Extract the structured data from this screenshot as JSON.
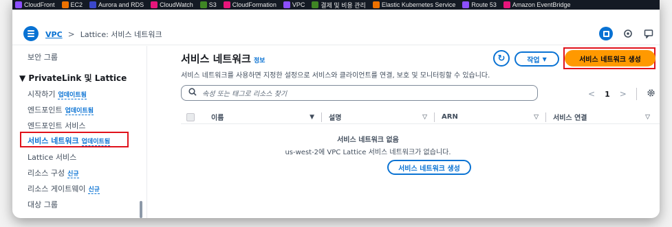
{
  "bookmarks": [
    {
      "label": "CloudFront",
      "color": "#8c4fff"
    },
    {
      "label": "EC2",
      "color": "#ed7100"
    },
    {
      "label": "Aurora and RDS",
      "color": "#3b48cc"
    },
    {
      "label": "CloudWatch",
      "color": "#e7157b"
    },
    {
      "label": "S3",
      "color": "#3f8624"
    },
    {
      "label": "CloudFormation",
      "color": "#e7157b"
    },
    {
      "label": "VPC",
      "color": "#8c4fff"
    },
    {
      "label": "결제 및 비용 관리",
      "color": "#3f8624"
    },
    {
      "label": "Elastic Kubernetes Service",
      "color": "#ed7100"
    },
    {
      "label": "Route 53",
      "color": "#8c4fff"
    },
    {
      "label": "Amazon EventBridge",
      "color": "#e7157b"
    }
  ],
  "breadcrumb": {
    "root": "VPC",
    "separator": ">",
    "current": "Lattice: 서비스 네트워크"
  },
  "sidebar": {
    "top_item": "보안 그룹",
    "section_title": "PrivateLink 및 Lattice",
    "items": [
      {
        "label": "시작하기",
        "badge": "업데이트됨"
      },
      {
        "label": "엔드포인트",
        "badge": "업데이트됨"
      },
      {
        "label": "엔드포인트 서비스",
        "badge": ""
      },
      {
        "label": "서비스 네트워크",
        "badge": "업데이트됨"
      },
      {
        "label": "Lattice 서비스",
        "badge": ""
      },
      {
        "label": "리소스 구성",
        "badge": "신규"
      },
      {
        "label": "리소스 게이트웨이",
        "badge": "신규"
      },
      {
        "label": "대상 그룹",
        "badge": ""
      }
    ]
  },
  "header": {
    "title": "서비스 네트워크",
    "info_link": "정보",
    "description": "서비스 네트워크를 사용하면 지정한 설정으로 서비스와 클라이언트를 연결, 보호 및 모니터링할 수 있습니다.",
    "actions_label": "작업",
    "create_label": "서비스 네트워크 생성"
  },
  "search": {
    "placeholder": "속성 또는 태그로 리소스 찾기"
  },
  "pagination": {
    "current_page": "1"
  },
  "table": {
    "columns": [
      "이름",
      "설명",
      "ARN",
      "서비스 연결"
    ]
  },
  "empty_state": {
    "title": "서비스 네트워크 없음",
    "description": "us-west-2에 VPC Lattice 서비스 네트워크가 없습니다.",
    "button_label": "서비스 네트워크 생성"
  },
  "colors": {
    "accent": "#0972d3",
    "primary_button": "#ff9900",
    "highlight_border": "#e0111a"
  }
}
